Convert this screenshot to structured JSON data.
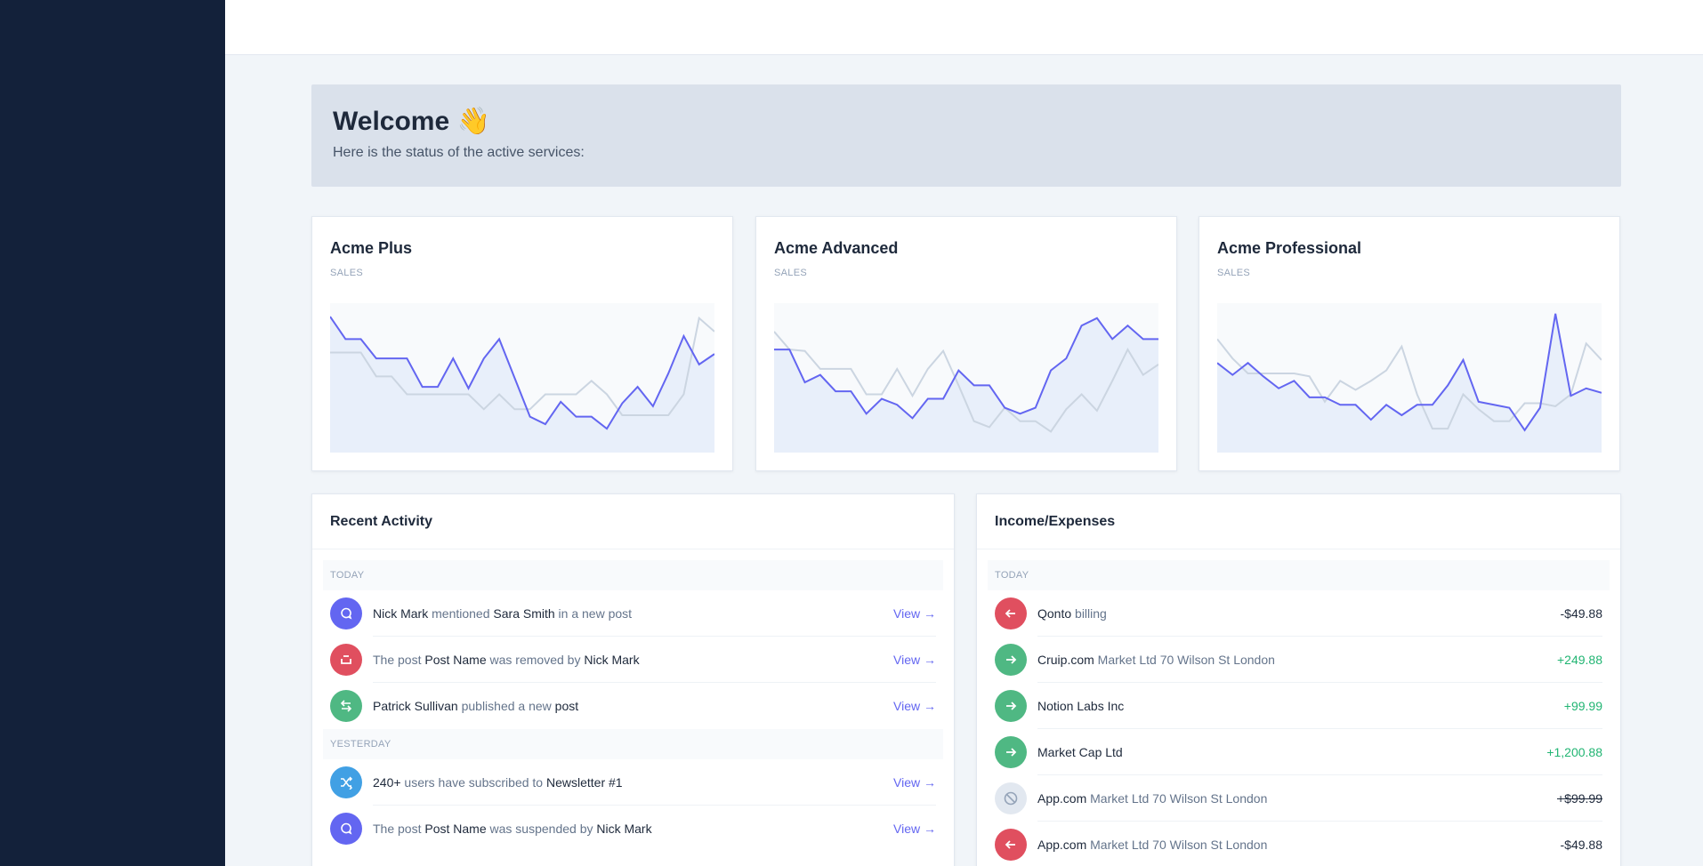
{
  "banner": {
    "title": "Welcome",
    "emoji": "👋",
    "subtitle": "Here is the status of the active services:"
  },
  "colors": {
    "accent": "#6366f1",
    "secondary_line": "#cbd5e1",
    "chart_fill": "#e8effa",
    "red": "#e04f5f",
    "green": "#4fb883",
    "sky": "#41a0e4",
    "muted": "#e2e8f0"
  },
  "chart_data": [
    {
      "type": "area",
      "title": "Acme Plus",
      "ylabel": "SALES",
      "series": [
        {
          "values": [
            91,
            76,
            76,
            63,
            63,
            63,
            44,
            44,
            63,
            43,
            63,
            76,
            50,
            24,
            19,
            34,
            24,
            24,
            16,
            33,
            44,
            31,
            53,
            78,
            59,
            66
          ]
        },
        {
          "values": [
            67,
            67,
            67,
            51,
            51,
            39,
            39,
            39,
            39,
            39,
            29,
            39,
            29,
            29,
            39,
            39,
            39,
            48,
            39,
            25,
            25,
            25,
            25,
            39,
            90,
            81
          ]
        }
      ]
    },
    {
      "type": "area",
      "title": "Acme Advanced",
      "ylabel": "SALES",
      "series": [
        {
          "values": [
            69,
            69,
            47,
            52,
            41,
            41,
            26,
            36,
            32,
            23,
            36,
            36,
            55,
            45,
            45,
            30,
            26,
            30,
            55,
            63,
            85,
            90,
            76,
            85,
            76,
            76
          ]
        },
        {
          "values": [
            81,
            69,
            68,
            56,
            56,
            56,
            39,
            39,
            56,
            38,
            56,
            68,
            45,
            21,
            17,
            30,
            21,
            21,
            14,
            29,
            39,
            28,
            48,
            69,
            52,
            59
          ]
        }
      ]
    },
    {
      "type": "area",
      "title": "Acme Professional",
      "ylabel": "SALES",
      "series": [
        {
          "values": [
            60,
            52,
            60,
            51,
            43,
            48,
            37,
            37,
            32,
            32,
            22,
            32,
            25,
            32,
            32,
            45,
            62,
            34,
            32,
            30,
            15,
            30,
            93,
            38,
            43,
            40
          ]
        },
        {
          "values": [
            76,
            63,
            53,
            53,
            53,
            53,
            51,
            34,
            48,
            42,
            48,
            55,
            71,
            39,
            16,
            16,
            39,
            29,
            21,
            21,
            33,
            33,
            31,
            39,
            73,
            62
          ]
        }
      ]
    }
  ],
  "activity": {
    "title": "Recent Activity",
    "groups": [
      {
        "label": "TODAY",
        "items": [
          {
            "icon": "chat-bubble-icon",
            "color": "#6366f1",
            "parts": [
              {
                "t": "Nick Mark",
                "s": true
              },
              {
                "t": " mentioned ",
                "s": false
              },
              {
                "t": "Sara Smith",
                "s": true
              },
              {
                "t": " in a new post",
                "s": false
              }
            ],
            "link": "View →"
          },
          {
            "icon": "remove-icon",
            "color": "#e04f5f",
            "parts": [
              {
                "t": "The post ",
                "s": false
              },
              {
                "t": "Post Name",
                "s": true
              },
              {
                "t": " was removed by ",
                "s": false
              },
              {
                "t": "Nick Mark",
                "s": true
              }
            ],
            "link": "View →"
          },
          {
            "icon": "swap-arrows-icon",
            "color": "#4fb883",
            "parts": [
              {
                "t": "Patrick Sullivan",
                "s": true
              },
              {
                "t": " published a new ",
                "s": false
              },
              {
                "t": "post",
                "s": true
              }
            ],
            "link": "View →"
          }
        ]
      },
      {
        "label": "YESTERDAY",
        "items": [
          {
            "icon": "shuffle-icon",
            "color": "#41a0e4",
            "parts": [
              {
                "t": "240+",
                "s": true
              },
              {
                "t": " users have subscribed to ",
                "s": false
              },
              {
                "t": "Newsletter #1",
                "s": true
              }
            ],
            "link": "View →"
          },
          {
            "icon": "chat-bubble-icon",
            "color": "#6366f1",
            "parts": [
              {
                "t": "The post ",
                "s": false
              },
              {
                "t": "Post Name",
                "s": true
              },
              {
                "t": " was suspended by ",
                "s": false
              },
              {
                "t": "Nick Mark",
                "s": true
              }
            ],
            "link": "View →"
          }
        ]
      }
    ]
  },
  "income": {
    "title": "Income/Expenses",
    "groups": [
      {
        "label": "TODAY",
        "items": [
          {
            "icon": "arrow-left-icon",
            "color": "#e04f5f",
            "parts": [
              {
                "t": "Qonto",
                "s": true
              },
              {
                "t": " billing",
                "s": false
              }
            ],
            "amount": "-$49.88",
            "amount_color": "#1e293b",
            "strike": false
          },
          {
            "icon": "arrow-right-icon",
            "color": "#4fb883",
            "parts": [
              {
                "t": "Cruip.com",
                "s": true
              },
              {
                "t": " Market Ltd 70 Wilson St London",
                "s": false
              }
            ],
            "amount": "+249.88",
            "amount_color": "#22b573",
            "strike": false
          },
          {
            "icon": "arrow-right-icon",
            "color": "#4fb883",
            "parts": [
              {
                "t": "Notion Labs Inc",
                "s": true
              }
            ],
            "amount": "+99.99",
            "amount_color": "#22b573",
            "strike": false
          },
          {
            "icon": "arrow-right-icon",
            "color": "#4fb883",
            "parts": [
              {
                "t": "Market Cap Ltd",
                "s": true
              }
            ],
            "amount": "+1,200.88",
            "amount_color": "#22b573",
            "strike": false
          },
          {
            "icon": "blocked-icon",
            "color": "#e2e8f0",
            "parts": [
              {
                "t": "App.com",
                "s": true
              },
              {
                "t": " Market Ltd 70 Wilson St London",
                "s": false
              }
            ],
            "amount": "+$99.99",
            "amount_color": "#1e293b",
            "strike": true
          },
          {
            "icon": "arrow-left-icon",
            "color": "#e04f5f",
            "parts": [
              {
                "t": "App.com",
                "s": true
              },
              {
                "t": " Market Ltd 70 Wilson St London",
                "s": false
              }
            ],
            "amount": "-$49.88",
            "amount_color": "#1e293b",
            "strike": false
          }
        ]
      }
    ]
  }
}
